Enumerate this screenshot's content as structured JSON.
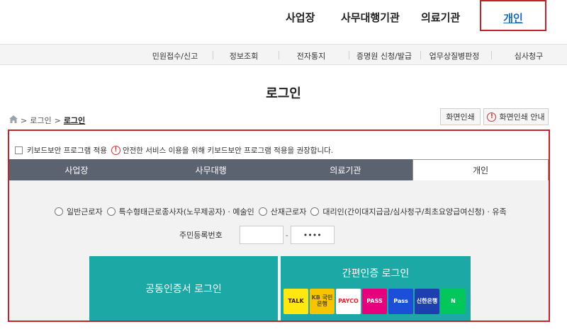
{
  "topnav": {
    "items": [
      "사업장",
      "사무대행기관",
      "의료기관"
    ],
    "active": "개인"
  },
  "menubar": {
    "items": [
      "민원접수/신고",
      "정보조회",
      "전자통지",
      "증명원 신청/발급",
      "업무상질병판정",
      "심사청구"
    ]
  },
  "page": {
    "title": "로그인"
  },
  "breadcrumb": {
    "home_icon": "home-icon",
    "items": [
      "로그인"
    ],
    "current": "로그인",
    "separator": ">"
  },
  "print": {
    "print_label": "화면인쇄",
    "guide_label": "화면인쇄 안내",
    "guide_icon_glyph": "!"
  },
  "keyboard_security": {
    "label": "키보드보안 프로그램 적용",
    "notice_icon_glyph": "!",
    "notice": "안전한 서비스 이용을 위해 키보드보안 프로그램 적용을 권장합니다.",
    "checked": false
  },
  "tabs": {
    "items": [
      "사업장",
      "사무대행",
      "의료기관",
      "개인"
    ],
    "active_index": 3
  },
  "worker_types": [
    "일반근로자",
    "특수형태근로종사자(노무제공자) · 예술인",
    "산재근로자",
    "대리인(간이대지급금/심사청구/최초요양급여신청) · 유족"
  ],
  "resident_number": {
    "label": "주민등록번호",
    "front_value": "",
    "back_value": "••••",
    "separator": "-"
  },
  "login_buttons": {
    "certificate": "공동인증서 로그인",
    "simple": "간편인증 로그인"
  },
  "simple_auth_providers": [
    {
      "name": "kakao",
      "label": "TALK",
      "bg": "#ffe812",
      "fg": "#3c1e1e"
    },
    {
      "name": "kb",
      "label": "KB 국민은행",
      "bg": "#f7c500",
      "fg": "#5a4a2a"
    },
    {
      "name": "payco",
      "label": "PAYCO",
      "bg": "#ffffff",
      "fg": "#e8212c"
    },
    {
      "name": "pass",
      "label": "PASS",
      "bg": "#e6007e",
      "fg": "#ffffff"
    },
    {
      "name": "samsung-pass",
      "label": "Pass",
      "bg": "#1d4ed8",
      "fg": "#ffffff"
    },
    {
      "name": "shinhan",
      "label": "신한은행",
      "bg": "#1e40af",
      "fg": "#ffffff"
    },
    {
      "name": "naver",
      "label": "N",
      "bg": "#03c75a",
      "fg": "#ffffff"
    }
  ],
  "colors": {
    "accent_red": "#c3232a",
    "teal": "#1ca9a6",
    "tab_dark": "#5c6370",
    "link_blue": "#1a6bb5"
  }
}
